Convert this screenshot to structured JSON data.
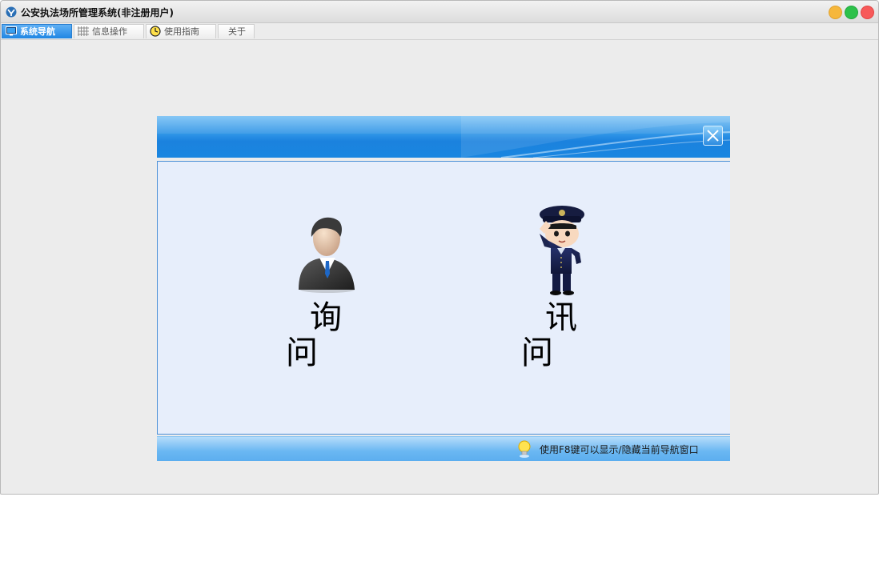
{
  "window": {
    "title": "公安执法场所管理系统(非注册用户)"
  },
  "tabs": [
    {
      "label": "系统导航",
      "icon": "monitor-icon",
      "active": true
    },
    {
      "label": "信息操作",
      "icon": "grid-icon",
      "active": false
    },
    {
      "label": "使用指南",
      "icon": "clock-icon",
      "active": false
    },
    {
      "label": "关于",
      "icon": "",
      "active": false
    }
  ],
  "navigation": {
    "options": [
      {
        "label": "询 问",
        "icon": "businessman-icon"
      },
      {
        "label": "讯 问",
        "icon": "police-officer-icon"
      }
    ],
    "hint": "使用F8键可以显示/隐藏当前导航窗口"
  },
  "colors": {
    "accent": "#1f86e3",
    "panel_background": "#e7eefb",
    "window_background": "#ececec"
  }
}
